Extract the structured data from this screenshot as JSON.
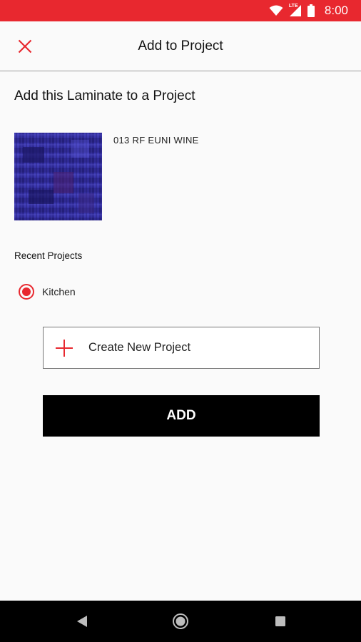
{
  "status_bar": {
    "time": "8:00",
    "network_label": "LTE",
    "background_color": "#e8282f",
    "icons": [
      "wifi-icon",
      "cell-signal-icon",
      "battery-icon"
    ]
  },
  "app_bar": {
    "title": "Add to Project",
    "close_icon": "close-icon"
  },
  "heading": "Add this Laminate to a Project",
  "product": {
    "name": "013 RF EUNI WINE",
    "swatch_color": "#2b2a8c"
  },
  "recent_projects": {
    "label": "Recent Projects",
    "items": [
      {
        "label": "Kitchen",
        "selected": true
      }
    ]
  },
  "create_button": {
    "label": "Create New Project",
    "icon": "plus-icon"
  },
  "add_button": {
    "label": "ADD"
  },
  "nav_bar": {
    "icons": [
      "back-icon",
      "home-icon",
      "recent-apps-icon"
    ]
  },
  "colors": {
    "accent": "#e8282f",
    "primary_button": "#000000"
  }
}
